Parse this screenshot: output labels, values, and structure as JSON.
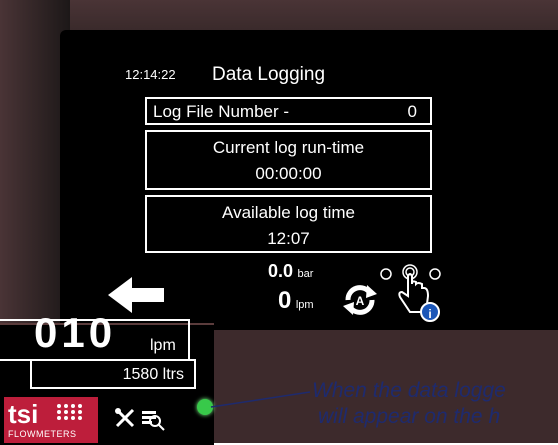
{
  "header": {
    "clock": "12:14:22",
    "title": "Data Logging"
  },
  "log_file": {
    "label": "Log File Number -",
    "value": "0"
  },
  "run_time": {
    "label": "Current log run-time",
    "value": "00:00:00"
  },
  "available": {
    "label": "Available log time",
    "value": "12:07"
  },
  "readings": {
    "pressure_value": "0.0",
    "pressure_unit": "bar",
    "flow_value": "0",
    "flow_unit": "lpm"
  },
  "inset": {
    "flow_value": "010",
    "flow_unit": "lpm",
    "total": "1580 ltrs",
    "logo_text": "tsi",
    "logo_sub": "FLOWMETERS"
  },
  "info_badge": "i",
  "caption": {
    "line1": "When the data logge",
    "line2": "will appear on the h"
  },
  "colors": {
    "logo_red": "#bd1e3b",
    "logging_indicator": "#38c94a",
    "info_blue": "#1b56b8",
    "caption": "#1e2a6e"
  },
  "icons": [
    "back-arrow-icon",
    "auto-mode-icon",
    "touch-icon",
    "tools-icon",
    "data-logging-icon"
  ]
}
